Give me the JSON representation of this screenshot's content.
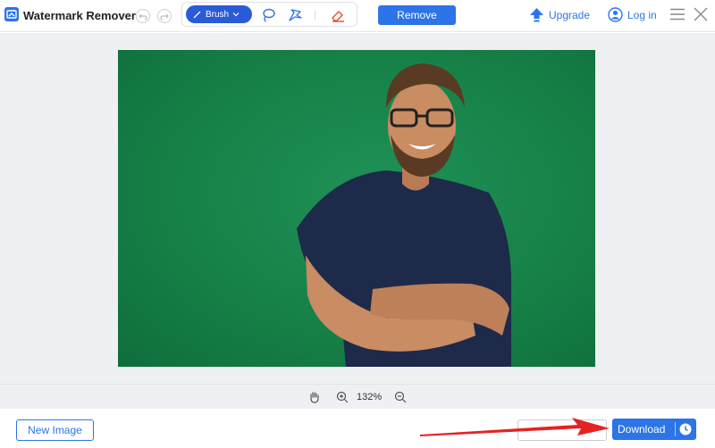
{
  "app": {
    "title": "Watermark Remover"
  },
  "toolbar": {
    "undo_icon": "undo-icon",
    "redo_icon": "redo-icon",
    "brush_label": "Brush",
    "lasso_icon": "lasso-icon",
    "polygon_icon": "polygonal-lasso-icon",
    "eraser_icon": "eraser-icon",
    "remove_label": "Remove",
    "upgrade_label": "Upgrade",
    "login_label": "Log in"
  },
  "zoom": {
    "level": "132%"
  },
  "footer": {
    "new_image_label": "New Image",
    "download_label": "Download"
  },
  "colors": {
    "accent": "#2d74e8",
    "brush_active": "#2a5bd7",
    "photo_background": "#168147",
    "annotation_arrow": "#e62222"
  }
}
